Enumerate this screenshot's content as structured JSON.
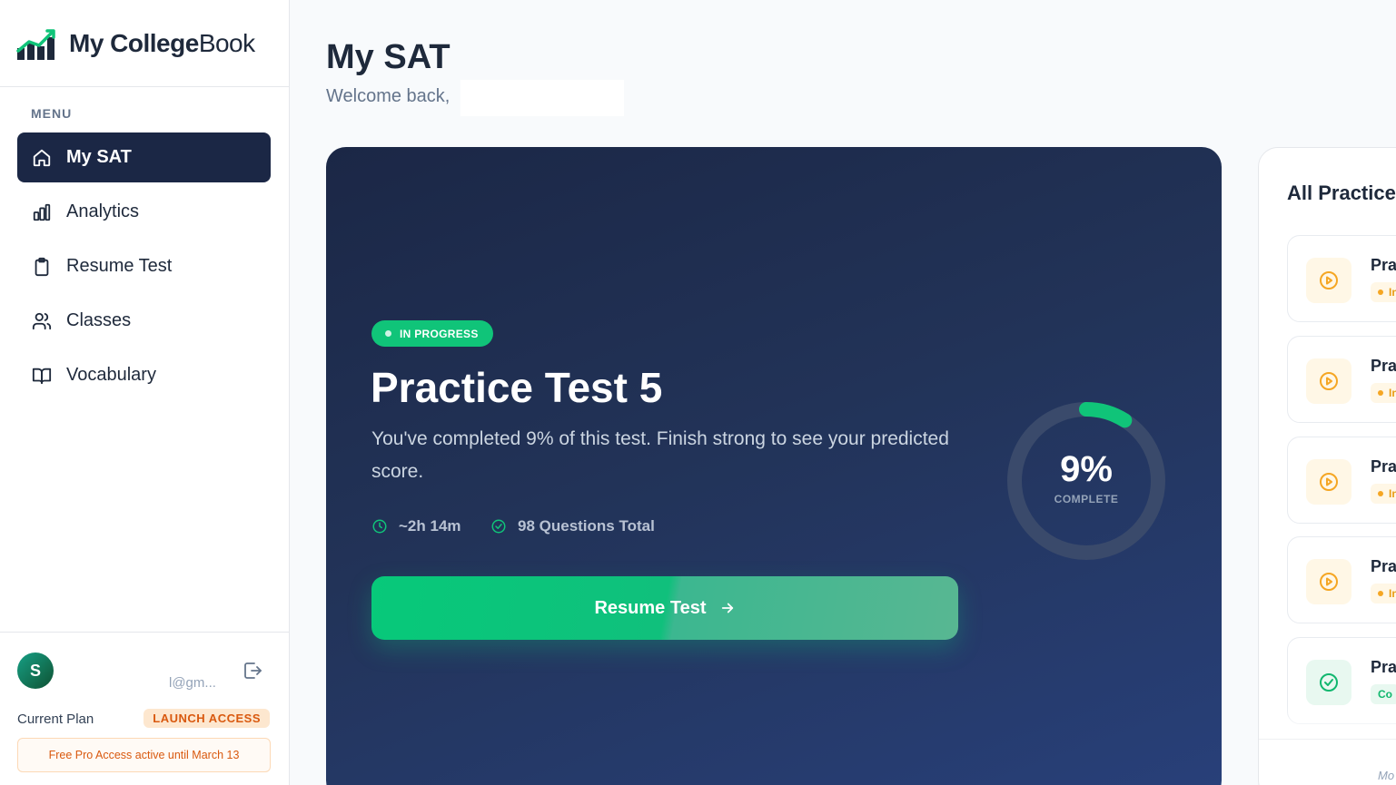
{
  "brand": {
    "name_bold": "My College",
    "name_light": "Book"
  },
  "sidebar": {
    "menu_heading": "MENU",
    "items": [
      {
        "label": "My SAT",
        "icon": "home-icon",
        "active": true
      },
      {
        "label": "Analytics",
        "icon": "bar-chart-icon",
        "active": false
      },
      {
        "label": "Resume Test",
        "icon": "clipboard-icon",
        "active": false
      },
      {
        "label": "Classes",
        "icon": "users-icon",
        "active": false
      },
      {
        "label": "Vocabulary",
        "icon": "book-open-icon",
        "active": false
      }
    ]
  },
  "user": {
    "avatar_initial": "S",
    "email": "l@gm...",
    "plan_label": "Current Plan",
    "plan_badge": "LAUNCH ACCESS",
    "plan_note": "Free Pro Access active until March 13"
  },
  "header": {
    "title": "My SAT",
    "welcome": "Welcome back,"
  },
  "hero": {
    "status": "IN PROGRESS",
    "title": "Practice Test 5",
    "description": "You've completed 9% of this test. Finish strong to see your predicted score.",
    "time": "~2h 14m",
    "questions": "98 Questions Total",
    "button_label": "Resume Test",
    "progress_text": "9%",
    "progress_value": 0.09,
    "progress_label": "COMPLETE"
  },
  "practice_panel": {
    "title": "All Practice",
    "items": [
      {
        "title": "Pra",
        "badge": "In",
        "status": "in-progress"
      },
      {
        "title": "Pra",
        "badge": "In",
        "status": "in-progress"
      },
      {
        "title": "Pra",
        "badge": "In",
        "status": "in-progress"
      },
      {
        "title": "Pra",
        "badge": "In",
        "status": "in-progress"
      },
      {
        "title": "Pra",
        "badge": "Co",
        "status": "completed"
      }
    ],
    "footer": "Mo"
  },
  "colors": {
    "accent_green": "#10c479",
    "navy": "#1b2745",
    "orange": "#d9590f",
    "amber": "#f5a623"
  }
}
